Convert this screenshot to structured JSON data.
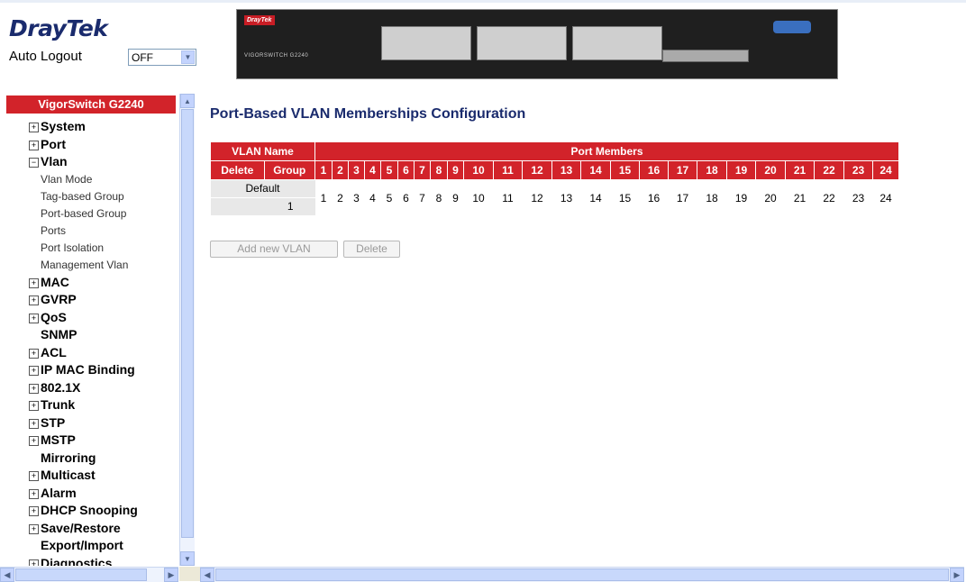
{
  "brand": {
    "name_a": "Dray",
    "name_b": "Tek"
  },
  "auto_logout": {
    "label": "Auto Logout",
    "value": "OFF"
  },
  "device": {
    "badge": "DrayTek",
    "model": "VIGORSWITCH G2240"
  },
  "nav": {
    "title": "VigorSwitch G2240",
    "items": [
      {
        "label": "System",
        "kind": "group",
        "expanded": false
      },
      {
        "label": "Port",
        "kind": "group",
        "expanded": false
      },
      {
        "label": "Vlan",
        "kind": "group",
        "expanded": true
      },
      {
        "label": "Vlan Mode",
        "kind": "sub"
      },
      {
        "label": "Tag-based Group",
        "kind": "sub"
      },
      {
        "label": "Port-based Group",
        "kind": "sub"
      },
      {
        "label": "Ports",
        "kind": "sub"
      },
      {
        "label": "Port Isolation",
        "kind": "sub"
      },
      {
        "label": "Management Vlan",
        "kind": "sub"
      },
      {
        "label": "MAC",
        "kind": "group",
        "expanded": false
      },
      {
        "label": "GVRP",
        "kind": "group",
        "expanded": false
      },
      {
        "label": "QoS",
        "kind": "group",
        "expanded": false
      },
      {
        "label": "SNMP",
        "kind": "plain"
      },
      {
        "label": "ACL",
        "kind": "group",
        "expanded": false
      },
      {
        "label": "IP MAC Binding",
        "kind": "group",
        "expanded": false
      },
      {
        "label": "802.1X",
        "kind": "group",
        "expanded": false
      },
      {
        "label": "Trunk",
        "kind": "group",
        "expanded": false
      },
      {
        "label": "STP",
        "kind": "group",
        "expanded": false
      },
      {
        "label": "MSTP",
        "kind": "group",
        "expanded": false
      },
      {
        "label": "Mirroring",
        "kind": "plain"
      },
      {
        "label": "Multicast",
        "kind": "group",
        "expanded": false
      },
      {
        "label": "Alarm",
        "kind": "group",
        "expanded": false
      },
      {
        "label": "DHCP Snooping",
        "kind": "group",
        "expanded": false
      },
      {
        "label": "Save/Restore",
        "kind": "group",
        "expanded": false
      },
      {
        "label": "Export/Import",
        "kind": "plain"
      },
      {
        "label": "Diagnostics",
        "kind": "group",
        "expanded": false
      }
    ]
  },
  "main": {
    "title": "Port-Based VLAN Memberships Configuration",
    "table": {
      "header_vlan_name": "VLAN Name",
      "header_port_members": "Port Members",
      "header_delete": "Delete",
      "header_group": "Group",
      "ports": [
        "1",
        "2",
        "3",
        "4",
        "5",
        "6",
        "7",
        "8",
        "9",
        "10",
        "11",
        "12",
        "13",
        "14",
        "15",
        "16",
        "17",
        "18",
        "19",
        "20",
        "21",
        "22",
        "23",
        "24"
      ],
      "rows": [
        {
          "name": "Default",
          "group": "1",
          "members": [
            "1",
            "2",
            "3",
            "4",
            "5",
            "6",
            "7",
            "8",
            "9",
            "10",
            "11",
            "12",
            "13",
            "14",
            "15",
            "16",
            "17",
            "18",
            "19",
            "20",
            "21",
            "22",
            "23",
            "24"
          ]
        }
      ]
    },
    "buttons": {
      "add": "Add new VLAN",
      "delete": "Delete"
    }
  }
}
